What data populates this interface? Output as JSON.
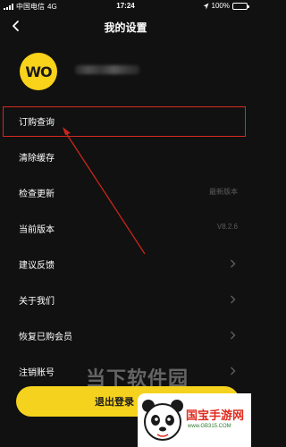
{
  "status_bar": {
    "carrier": "中国电信",
    "network": "4G",
    "time": "17:24",
    "battery_percent": "100%",
    "battery_level": 1.0
  },
  "nav": {
    "title": "我的设置"
  },
  "profile": {
    "avatar_text": "WO",
    "avatar_color": "#f9d21a"
  },
  "menu": {
    "items": [
      {
        "label": "订购查询",
        "value": ""
      },
      {
        "label": "清除缓存",
        "value": ""
      },
      {
        "label": "检查更新",
        "value": "最新版本"
      },
      {
        "label": "当前版本",
        "value": "V8.2.6"
      },
      {
        "label": "建议反馈",
        "value": ""
      },
      {
        "label": "关于我们",
        "value": ""
      },
      {
        "label": "恢复已购会员",
        "value": ""
      },
      {
        "label": "注销账号",
        "value": ""
      }
    ]
  },
  "logout": {
    "label": "退出登录"
  },
  "watermark": {
    "text": "当下软件园",
    "site_title": "国宝手游网",
    "site_url": "www.GB315.COM"
  },
  "colors": {
    "accent": "#f5d21d",
    "highlight": "#d6291f",
    "background": "#111111"
  }
}
